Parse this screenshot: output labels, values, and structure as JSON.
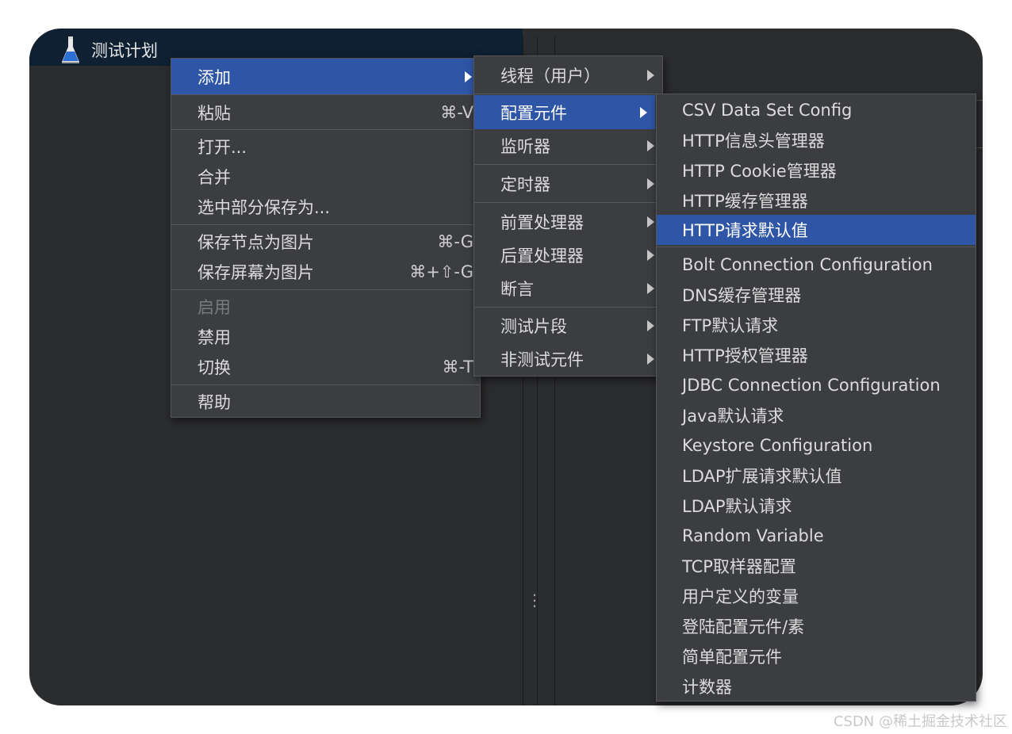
{
  "tree": {
    "root_label": "测试计划",
    "root_icon": "flask-icon"
  },
  "menu_add": {
    "items": [
      {
        "label": "添加",
        "shortcut": "",
        "submenu": true
      },
      {
        "label": "粘贴",
        "shortcut": "⌘-V"
      },
      {
        "label": "打开...",
        "shortcut": ""
      },
      {
        "label": "合并",
        "shortcut": ""
      },
      {
        "label": "选中部分保存为...",
        "shortcut": ""
      },
      {
        "label": "保存节点为图片",
        "shortcut": "⌘-G"
      },
      {
        "label": "保存屏幕为图片",
        "shortcut": "⌘+⇧-G"
      },
      {
        "label": "启用",
        "shortcut": "",
        "disabled": true
      },
      {
        "label": "禁用",
        "shortcut": ""
      },
      {
        "label": "切换",
        "shortcut": "⌘-T"
      },
      {
        "label": "帮助",
        "shortcut": ""
      }
    ]
  },
  "menu_add_sub": {
    "items": [
      {
        "label": "线程（用户）"
      },
      {
        "label": "配置元件"
      },
      {
        "label": "监听器"
      },
      {
        "label": "定时器"
      },
      {
        "label": "前置处理器"
      },
      {
        "label": "后置处理器"
      },
      {
        "label": "断言"
      },
      {
        "label": "测试片段"
      },
      {
        "label": "非测试元件"
      }
    ]
  },
  "menu_config": {
    "items": [
      "CSV Data Set Config",
      "HTTP信息头管理器",
      "HTTP Cookie管理器",
      "HTTP缓存管理器",
      "HTTP请求默认值",
      "Bolt Connection Configuration",
      "DNS缓存管理器",
      "FTP默认请求",
      "HTTP授权管理器",
      "JDBC Connection Configuration",
      "Java默认请求",
      "Keystore Configuration",
      "LDAP扩展请求默认值",
      "LDAP默认请求",
      "Random Variable",
      "TCP取样器配置",
      "用户定义的变量",
      "登陆配置元件/素",
      "简单配置元件",
      "计数器"
    ]
  },
  "watermark": "CSDN @稀土掘金技术社区",
  "colors": {
    "window_bg": "#2b2c2e",
    "menu_bg": "#3b3d41",
    "selection": "#2f56a6",
    "tree_header": "#0f2033"
  }
}
